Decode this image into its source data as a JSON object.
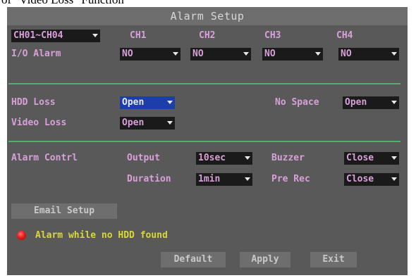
{
  "caption": "of \"Video Loss\" Function",
  "window": {
    "title": "Alarm Setup"
  },
  "channels": {
    "group_select": "CH01~CH04",
    "headers": [
      "CH1",
      "CH2",
      "CH3",
      "CH4"
    ]
  },
  "io_alarm": {
    "label": "I/O Alarm",
    "values": [
      "NO",
      "NO",
      "NO",
      "NO"
    ]
  },
  "hdd_loss": {
    "label": "HDD Loss",
    "value": "Open"
  },
  "no_space": {
    "label": "No Space",
    "value": "Open"
  },
  "video_loss": {
    "label": "Video Loss",
    "value": "Open"
  },
  "alarm_control": {
    "label": "Alarm Contrl",
    "output_label": "Output",
    "output_value": "10sec",
    "buzzer_label": "Buzzer",
    "buzzer_value": "Close",
    "duration_label": "Duration",
    "duration_value": "1min",
    "prerec_label": "Pre Rec",
    "prerec_value": "Close"
  },
  "email_setup": {
    "label": "Email Setup"
  },
  "status": {
    "message": "Alarm while no HDD found",
    "indicator_color": "#e01818"
  },
  "footer": {
    "default_label": "Default",
    "apply_label": "Apply",
    "exit_label": "Exit"
  },
  "colors": {
    "panel": "#595959",
    "title_bar": "#6e6e6e",
    "dropdown": "#1a1a1a",
    "dropdown_selected": "#1c3ea8",
    "label_pink": "#d8a0d8",
    "label_yellow": "#d8d838",
    "divider": "#50b070"
  }
}
